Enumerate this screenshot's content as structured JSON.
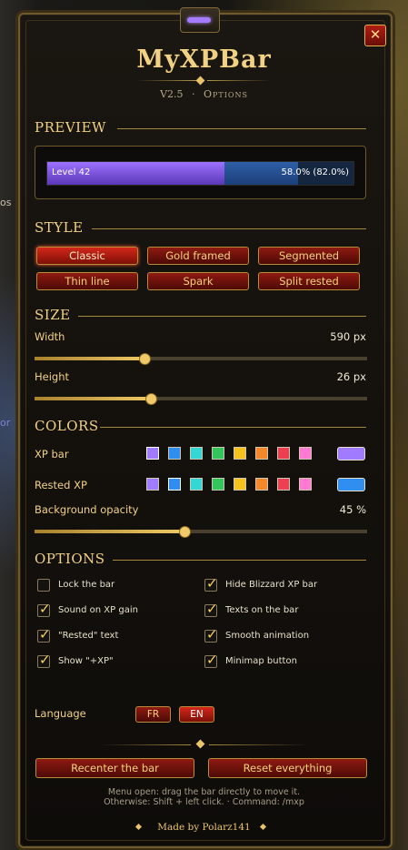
{
  "background": {
    "left_text_1": "os",
    "left_text_2": "or"
  },
  "header": {
    "title": "MyXPBar",
    "version": "V2.5",
    "separator": "·",
    "page": "Options",
    "close_label": "✕"
  },
  "preview": {
    "section_title": "PREVIEW",
    "level_text": "Level 42",
    "progress_text": "58.0% (82.0%)",
    "xp_fraction": 0.58,
    "rested_fraction": 0.82
  },
  "style": {
    "section_title": "STYLE",
    "buttons": [
      "Classic",
      "Gold framed",
      "Segmented",
      "Thin line",
      "Spark",
      "Split rested"
    ],
    "selected": "Classic"
  },
  "size": {
    "section_title": "SIZE",
    "width_label": "Width",
    "width_value": "590 px",
    "width_fraction": 0.33,
    "height_label": "Height",
    "height_value": "26 px",
    "height_fraction": 0.35
  },
  "colors": {
    "section_title": "COLORS",
    "xp_label": "XP bar",
    "rested_label": "Rested XP",
    "palette": [
      "#a17bff",
      "#2f8ef0",
      "#35d6d6",
      "#35c45b",
      "#f6c21d",
      "#f5872b",
      "#ec3f52",
      "#ff7ad0"
    ],
    "xp_selected": "#a17bff",
    "rested_selected": "#2f8ef0",
    "opacity_label": "Background opacity",
    "opacity_value": "45 %",
    "opacity_fraction": 0.45
  },
  "options": {
    "section_title": "OPTIONS",
    "items": [
      {
        "label": "Lock the bar",
        "checked": false
      },
      {
        "label": "Hide Blizzard XP bar",
        "checked": true
      },
      {
        "label": "Sound on XP gain",
        "checked": true
      },
      {
        "label": "Texts on the bar",
        "checked": true
      },
      {
        "label": "\"Rested\" text",
        "checked": true
      },
      {
        "label": "Smooth animation",
        "checked": true
      },
      {
        "label": "Show \"+XP\"",
        "checked": true
      },
      {
        "label": "Minimap button",
        "checked": true
      }
    ]
  },
  "language": {
    "label": "Language",
    "fr": "FR",
    "en": "EN",
    "selected": "EN"
  },
  "actions": {
    "recenter": "Recenter the bar",
    "reset": "Reset everything"
  },
  "hints": {
    "line1": "Menu open: drag the bar directly to move it.",
    "line2": "Otherwise: Shift + left click.  ·  Command: /mxp"
  },
  "footer": {
    "text": "Made by Polarz141"
  }
}
